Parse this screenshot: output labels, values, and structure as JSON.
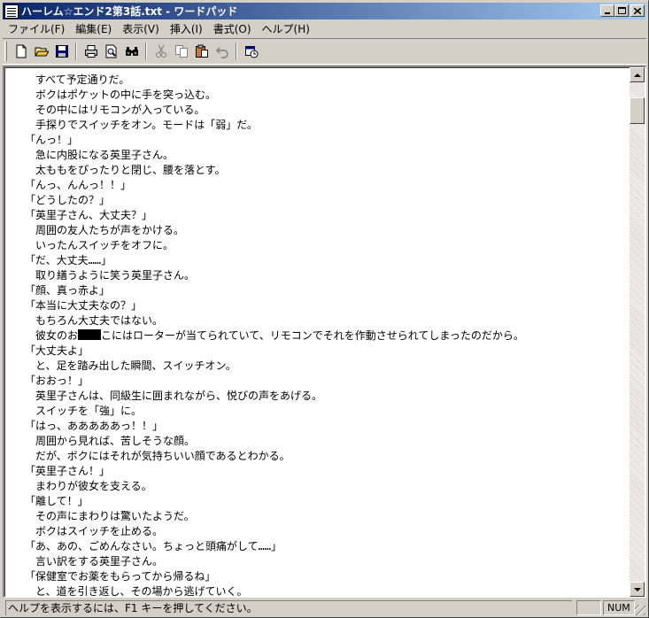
{
  "window": {
    "title": "ハーレム☆エンド2第3話.txt - ワードパッド"
  },
  "menu": [
    "ファイル(F)",
    "編集(E)",
    "表示(V)",
    "挿入(I)",
    "書式(O)",
    "ヘルプ(H)"
  ],
  "toolbar": {
    "icons": [
      "new-document-icon",
      "open-folder-icon",
      "save-icon",
      "print-icon",
      "print-preview-icon",
      "find-icon",
      "cut-icon",
      "copy-icon",
      "paste-icon",
      "undo-icon",
      "date-time-icon"
    ]
  },
  "document": {
    "lines": [
      "　すべて予定通りだ。",
      "　ボクはポケットの中に手を突っ込む。",
      "　その中にはリモコンが入っている。",
      "　手探りでスイッチをオン。モードは「弱」だ。",
      "「んっ！」",
      "　急に内股になる英里子さん。",
      "　太ももをぴったりと閉じ、腰を落とす。",
      "「んっ、んんっ！！」",
      "「どうしたの？」",
      "「英里子さん、大丈夫？」",
      "　周囲の友人たちが声をかける。",
      "　いったんスイッチをオフに。",
      "「だ、大丈夫……」",
      "　取り繕うように笑う英里子さん。",
      "「顔、真っ赤よ」",
      "「本当に大丈夫なの？」",
      "　もちろん大丈夫ではない。",
      "REDACTED_LINE",
      "「大丈夫よ」",
      "　と、足を踏み出した瞬間、スイッチオン。",
      "「おおっ！」",
      "　英里子さんは、同級生に囲まれながら、悦びの声をあげる。",
      "　スイッチを「強」に。",
      "「はっ、あああああっ！！」",
      "　周囲から見れば、苦しそうな顔。",
      "　だが、ボクにはそれが気持ちいい顔であるとわかる。",
      "「英里子さん！」",
      "　まわりが彼女を支える。",
      "「離して！」",
      "　その声にまわりは驚いたようだ。",
      "　ボクはスイッチを止める。",
      "「あ、あの、ごめんなさい。ちょっと頭痛がして……」",
      "　言い訳をする英里子さん。",
      "「保健室でお薬をもらってから帰るね」",
      "　と、道を引き返し、その場から逃げていく。"
    ],
    "redacted_line": {
      "before": "　彼女のお",
      "after": "こにはローターが当てられていて、リモコンでそれを作動させられてしまったのだから。"
    }
  },
  "statusbar": {
    "help_text": "ヘルプを表示するには、F1 キーを押してください。",
    "panel_1": "",
    "panel_2": "NUM"
  }
}
